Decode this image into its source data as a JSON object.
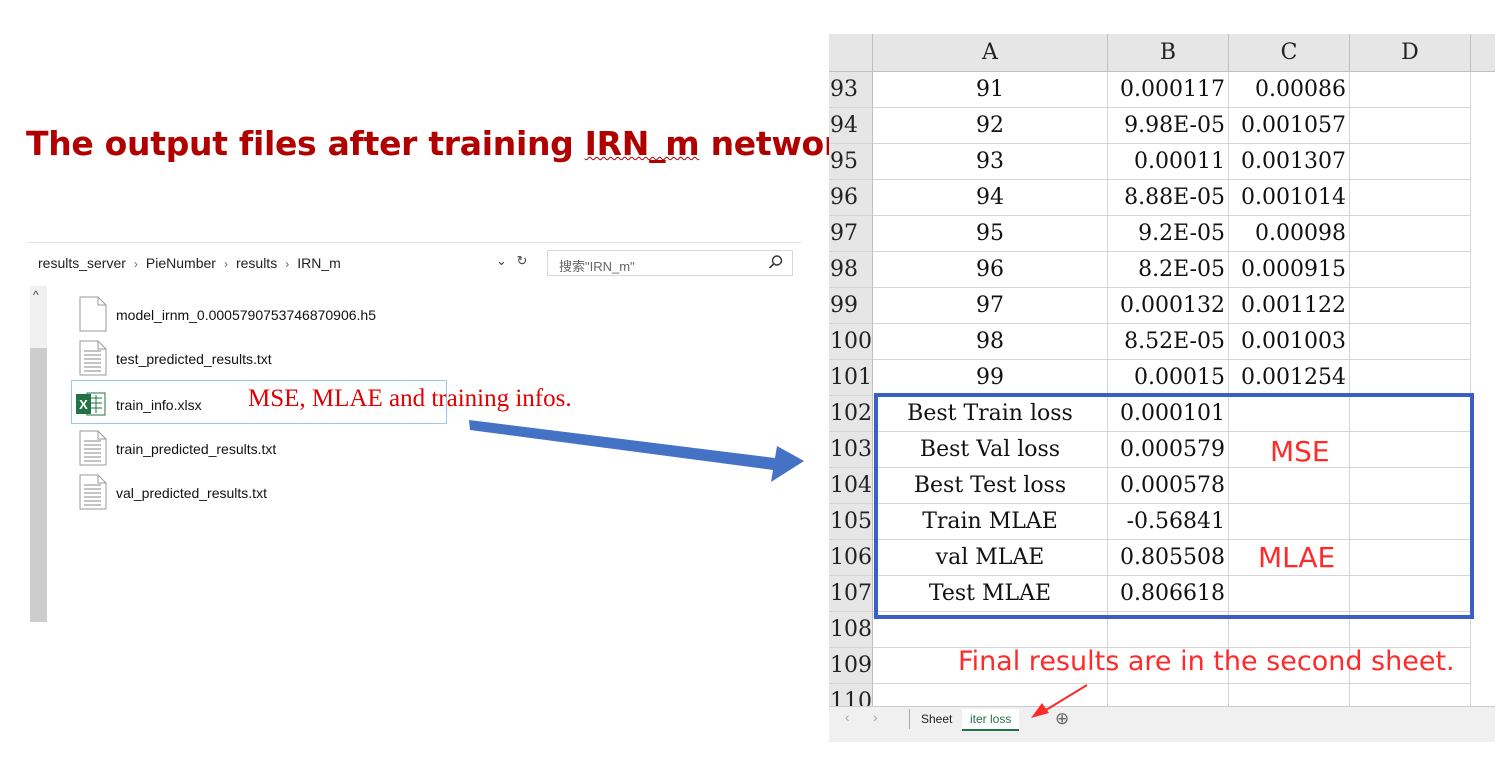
{
  "heading": {
    "prefix": "The output files after training ",
    "underlined": "IRN_m",
    "suffix": " network."
  },
  "explorer": {
    "breadcrumb": [
      "results_server",
      "PieNumber",
      "results",
      "IRN_m"
    ],
    "refresh_icon": "↻",
    "dropdown_icon": "⌄",
    "search_placeholder": "搜索\"IRN_m\"",
    "files": [
      {
        "name": "model_irnm_0.0005790753746870906.h5",
        "icon": "blank-file-icon"
      },
      {
        "name": "test_predicted_results.txt",
        "icon": "text-file-icon"
      },
      {
        "name": "train_info.xlsx",
        "icon": "excel-file-icon"
      },
      {
        "name": "train_predicted_results.txt",
        "icon": "text-file-icon"
      },
      {
        "name": "val_predicted_results.txt",
        "icon": "text-file-icon"
      }
    ],
    "selected_index": 2
  },
  "annotation_files": "MSE, MLAE and training infos.",
  "spreadsheet": {
    "columns": [
      "A",
      "B",
      "C",
      "D"
    ],
    "rows": [
      {
        "n": "93",
        "a": "91",
        "b": "0.000117",
        "c": "0.00086"
      },
      {
        "n": "94",
        "a": "92",
        "b": "9.98E-05",
        "c": "0.001057"
      },
      {
        "n": "95",
        "a": "93",
        "b": "0.00011",
        "c": "0.001307"
      },
      {
        "n": "96",
        "a": "94",
        "b": "8.88E-05",
        "c": "0.001014"
      },
      {
        "n": "97",
        "a": "95",
        "b": "9.2E-05",
        "c": "0.00098"
      },
      {
        "n": "98",
        "a": "96",
        "b": "8.2E-05",
        "c": "0.000915"
      },
      {
        "n": "99",
        "a": "97",
        "b": "0.000132",
        "c": "0.001122"
      },
      {
        "n": "100",
        "a": "98",
        "b": "8.52E-05",
        "c": "0.001003"
      },
      {
        "n": "101",
        "a": "99",
        "b": "0.00015",
        "c": "0.001254"
      },
      {
        "n": "102",
        "a": "Best Train loss",
        "b": "0.000101",
        "c": ""
      },
      {
        "n": "103",
        "a": "Best Val loss",
        "b": "0.000579",
        "c": ""
      },
      {
        "n": "104",
        "a": "Best Test loss",
        "b": "0.000578",
        "c": ""
      },
      {
        "n": "105",
        "a": "Train MLAE",
        "b": "-0.56841",
        "c": ""
      },
      {
        "n": "106",
        "a": "val MLAE",
        "b": "0.805508",
        "c": ""
      },
      {
        "n": "107",
        "a": "Test MLAE",
        "b": "0.806618",
        "c": ""
      },
      {
        "n": "108",
        "a": "",
        "b": "",
        "c": ""
      },
      {
        "n": "109",
        "a": "",
        "b": "",
        "c": ""
      },
      {
        "n": "110",
        "a": "",
        "b": "",
        "c": ""
      }
    ],
    "sheet_tabs": [
      "Sheet",
      "iter loss"
    ],
    "active_tab": "iter loss",
    "add_sheet_icon": "⊕",
    "nav_left": "‹",
    "nav_right": "›"
  },
  "labels": {
    "mse": "MSE",
    "mlae": "MLAE"
  },
  "annotation_sheet": "Final results are in the second sheet.",
  "colors": {
    "title": "#b00000",
    "annotation": "#ff2a2a",
    "box": "#3a5fc8",
    "arrow": "#4472c4",
    "excel_green": "#217346"
  }
}
